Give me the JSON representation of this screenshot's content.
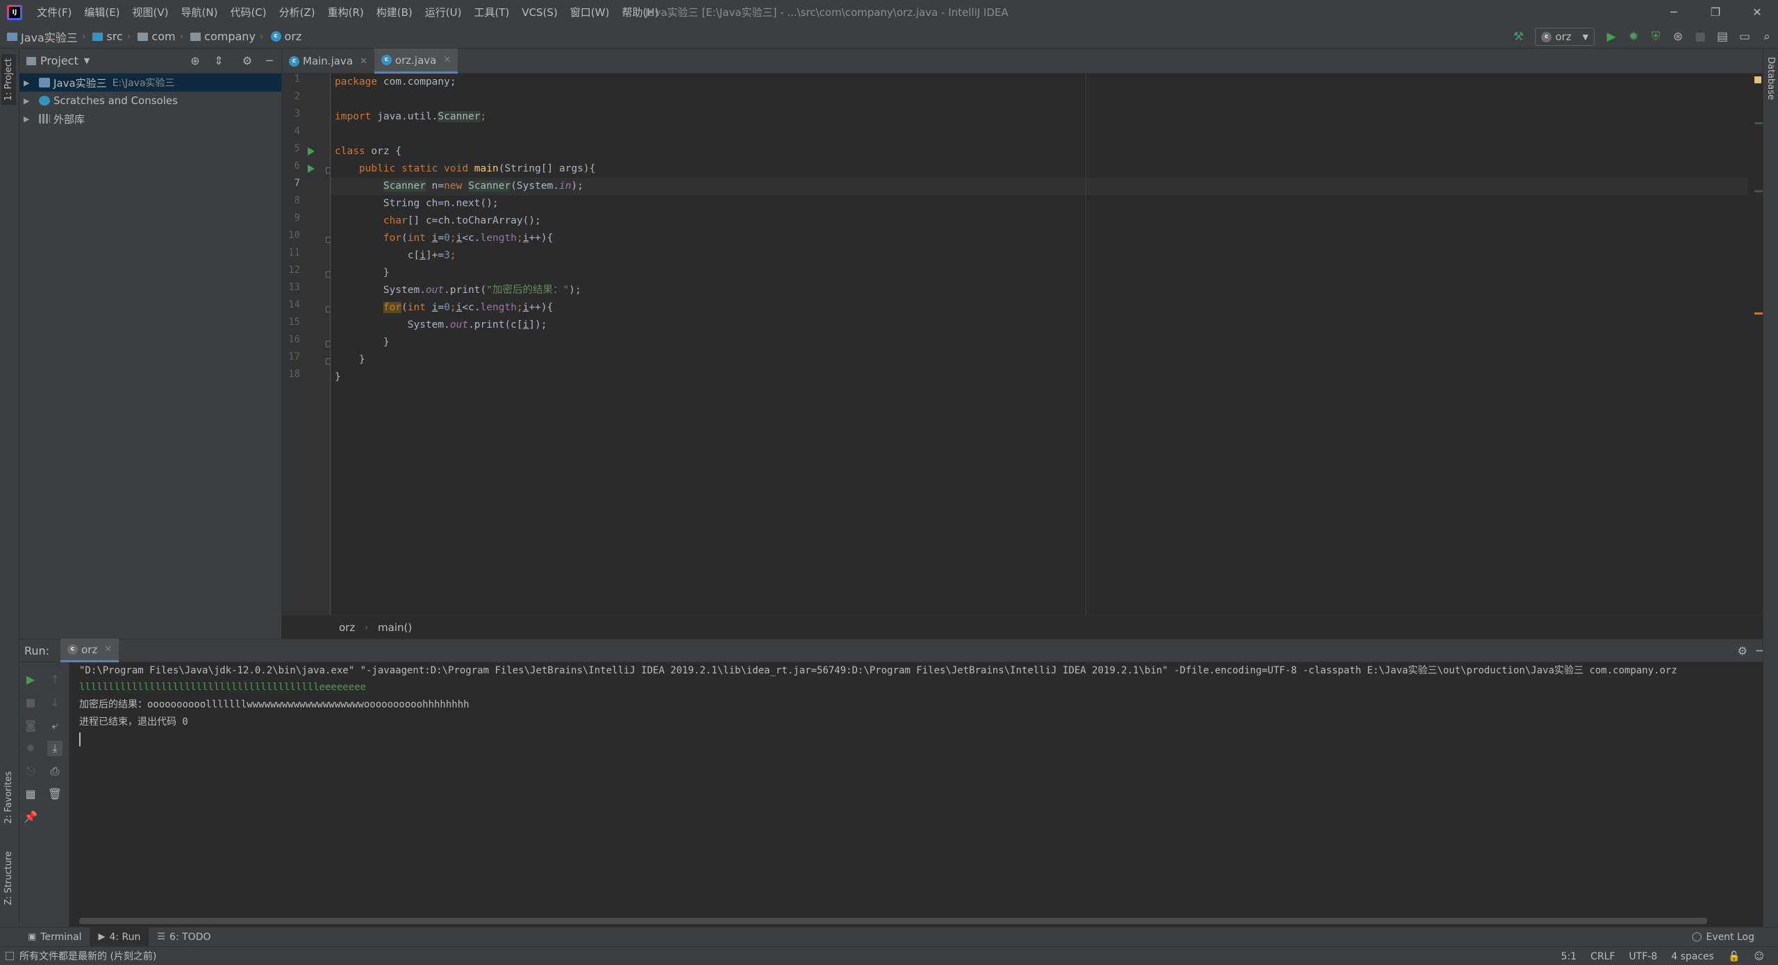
{
  "menubar": {
    "items": [
      "文件(F)",
      "编辑(E)",
      "视图(V)",
      "导航(N)",
      "代码(C)",
      "分析(Z)",
      "重构(R)",
      "构建(B)",
      "运行(U)",
      "工具(T)",
      "VCS(S)",
      "窗口(W)",
      "帮助(H)"
    ],
    "window_title": "Java实验三 [E:\\Java实验三] - ...\\src\\com\\company\\orz.java - IntelliJ IDEA"
  },
  "navbar": {
    "breadcrumbs": [
      "Java实验三",
      "src",
      "com",
      "company",
      "orz"
    ],
    "run_config": "orz"
  },
  "left_stripe": {
    "project": "1: Project",
    "favorites": "2: Favorites",
    "structure": "Z: Structure"
  },
  "right_stripe": {
    "database": "Database"
  },
  "project_panel": {
    "title": "Project",
    "tree": [
      {
        "label": "Java实验三",
        "sub": "E:\\Java实验三",
        "selected": true
      },
      {
        "label": "Scratches and Consoles",
        "sub": ""
      },
      {
        "label": "外部库",
        "sub": ""
      }
    ]
  },
  "editor": {
    "tabs": [
      {
        "label": "Main.java",
        "active": false
      },
      {
        "label": "orz.java",
        "active": true
      }
    ],
    "line_numbers": [
      "1",
      "2",
      "3",
      "4",
      "5",
      "6",
      "7",
      "8",
      "9",
      "10",
      "11",
      "12",
      "13",
      "14",
      "15",
      "16",
      "17",
      "18"
    ],
    "lines": {
      "l1": [
        "package",
        " com.company;"
      ],
      "l3": [
        "import",
        " java.util.",
        "Scanner",
        ";"
      ],
      "l5": [
        "class",
        " orz {"
      ],
      "l6": [
        "    ",
        "public static void",
        " ",
        "main",
        "(String[] args){"
      ],
      "l7": [
        "        ",
        "Scanner",
        " n=",
        "new",
        " ",
        "Scanner",
        "(System.",
        "in",
        ");"
      ],
      "l8": [
        "        String ch=n.next();"
      ],
      "l9": [
        "        ",
        "char",
        "[] c=ch.toCharArray();"
      ],
      "l10": [
        "        ",
        "for",
        "(",
        "int",
        " ",
        "i",
        "=",
        "0",
        ";",
        "i",
        "<c.",
        "length",
        ";",
        "i",
        "++){"
      ],
      "l11": [
        "            c[",
        "i",
        "]+=",
        "3",
        ";"
      ],
      "l12": [
        "        }"
      ],
      "l13": [
        "        System.",
        "out",
        ".print(",
        "\"加密后的结果：\"",
        ");"
      ],
      "l14": [
        "        ",
        "for",
        "(",
        "int",
        " ",
        "i",
        "=",
        "0",
        ";",
        "i",
        "<c.",
        "length",
        ";",
        "i",
        "++){"
      ],
      "l15": [
        "            System.",
        "out",
        ".print(c[",
        "i",
        "]);"
      ],
      "l16": [
        "        }"
      ],
      "l17": [
        "    }"
      ],
      "l18": [
        "}"
      ]
    },
    "breadcrumb": [
      "orz",
      "main()"
    ]
  },
  "run_panel": {
    "label": "Run:",
    "tab": "orz",
    "output": [
      "\"D:\\Program Files\\Java\\jdk-12.0.2\\bin\\java.exe\" \"-javaagent:D:\\Program Files\\JetBrains\\IntelliJ IDEA 2019.2.1\\lib\\idea_rt.jar=56749:D:\\Program Files\\JetBrains\\IntelliJ IDEA 2019.2.1\\bin\" -Dfile.encoding=UTF-8 -classpath E:\\Java实验三\\out\\production\\Java实验三 com.company.orz",
      "llllllllllllllllllllllllllllllllllllllllleeeeeeee",
      "加密后的结果：oooooooooolllllllwwwwwwwwwwwwwwwwwwwwoooooooooohhhhhhhh",
      "进程已结束，退出代码 0"
    ]
  },
  "tool_tabs": [
    {
      "label": "Terminal",
      "icon": "terminal-icon"
    },
    {
      "label": "4: Run",
      "icon": "run-icon"
    },
    {
      "label": "6: TODO",
      "icon": "todo-icon"
    }
  ],
  "event_log": "Event Log",
  "statusbar": {
    "message": "所有文件都是最新的 (片刻之前)",
    "position": "5:1",
    "line_sep": "CRLF",
    "encoding": "UTF-8",
    "indent": "4 spaces"
  },
  "colors": {
    "keyword": "#cc7832",
    "method": "#ffc66d",
    "string": "#6a8759",
    "static_field": "#9876aa",
    "number": "#6897bb",
    "console_green": "#499c54"
  }
}
